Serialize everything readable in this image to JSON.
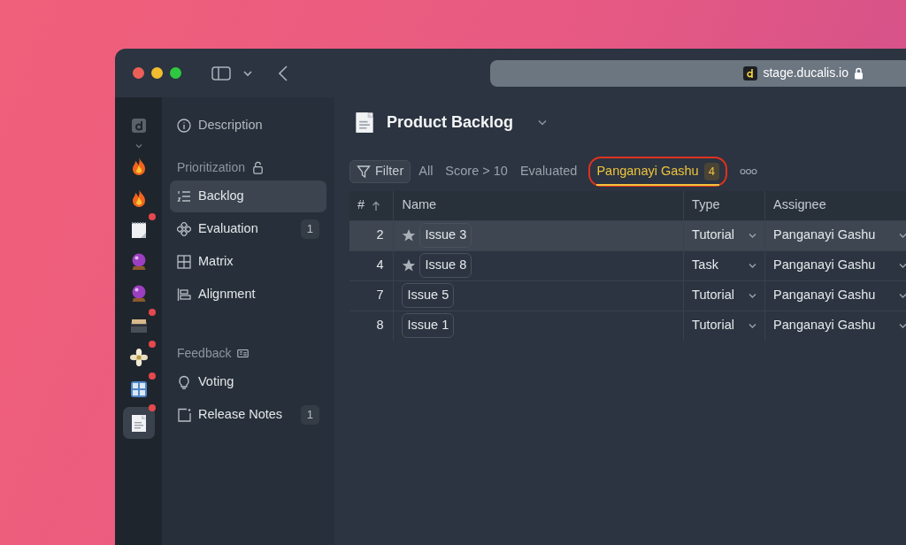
{
  "browser": {
    "url": "stage.ducalis.io"
  },
  "rail": [
    {
      "kind": "logo",
      "selected": false,
      "dot": false
    },
    {
      "kind": "fire",
      "selected": false,
      "dot": false
    },
    {
      "kind": "fire",
      "selected": false,
      "dot": false
    },
    {
      "kind": "notepad",
      "selected": false,
      "dot": true
    },
    {
      "kind": "crystal-ball",
      "selected": false,
      "dot": false
    },
    {
      "kind": "crystal-ball",
      "selected": false,
      "dot": false
    },
    {
      "kind": "card-box",
      "selected": false,
      "dot": true
    },
    {
      "kind": "flower",
      "selected": false,
      "dot": true
    },
    {
      "kind": "numbers",
      "selected": false,
      "dot": true
    },
    {
      "kind": "document",
      "selected": true,
      "dot": true
    }
  ],
  "sidebar": {
    "top": {
      "label": "Description"
    },
    "sections": [
      {
        "title": "Prioritization",
        "kind": "lock",
        "items": [
          {
            "label": "Backlog",
            "kind": "list",
            "selected": true
          },
          {
            "label": "Evaluation",
            "kind": "nodes",
            "selected": false,
            "count": "1"
          },
          {
            "label": "Matrix",
            "kind": "grid",
            "selected": false
          },
          {
            "label": "Alignment",
            "kind": "align",
            "selected": false
          }
        ]
      },
      {
        "title": "Feedback",
        "kind": "card",
        "items": [
          {
            "label": "Voting",
            "kind": "bulb",
            "selected": false
          },
          {
            "label": "Release Notes",
            "kind": "note",
            "selected": false,
            "count": "1"
          }
        ]
      }
    ]
  },
  "header": {
    "title": "Product Backlog"
  },
  "filter_button": "Filter",
  "tabs": [
    {
      "label": "All",
      "selected": false,
      "highlighted": false
    },
    {
      "label": "Score > 10",
      "selected": false,
      "highlighted": false
    },
    {
      "label": "Evaluated",
      "selected": false,
      "highlighted": false
    },
    {
      "label": "Panganayi Gashu",
      "selected": true,
      "highlighted": true,
      "count": "4"
    }
  ],
  "table": {
    "columns": [
      "#",
      "Name",
      "Type",
      "Assignee"
    ],
    "rows": [
      {
        "number": "2",
        "starred": true,
        "name": "Issue 3",
        "type": "Tutorial",
        "assignee": "Panganayi Gashu",
        "selected": true
      },
      {
        "number": "4",
        "starred": true,
        "name": "Issue 8",
        "type": "Task",
        "assignee": "Panganayi Gashu",
        "selected": false
      },
      {
        "number": "7",
        "starred": false,
        "name": "Issue 5",
        "type": "Tutorial",
        "assignee": "Panganayi Gashu",
        "selected": false
      },
      {
        "number": "8",
        "starred": false,
        "name": "Issue 1",
        "type": "Tutorial",
        "assignee": "Panganayi Gashu",
        "selected": false
      }
    ]
  }
}
